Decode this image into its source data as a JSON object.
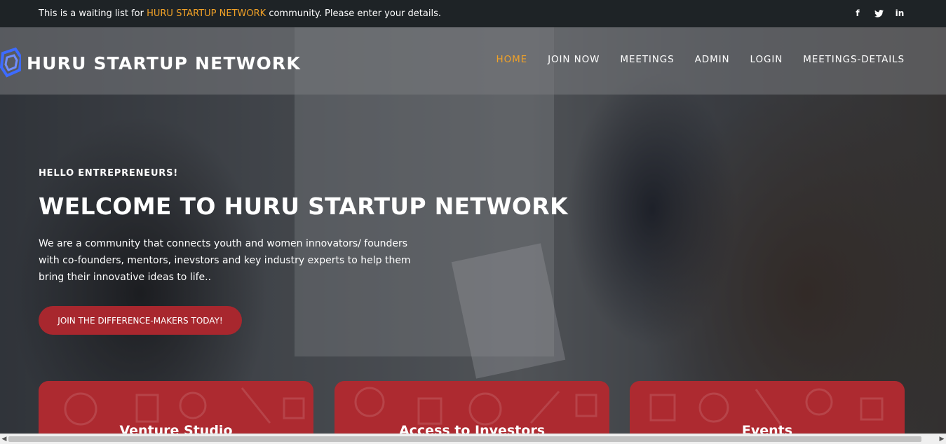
{
  "topbar": {
    "message_prefix": "This is a waiting list for ",
    "message_accent": "HURU STARTUP NETWORK",
    "message_suffix": " community. Please enter your details.",
    "social": [
      {
        "icon": "facebook-icon",
        "glyph": "f"
      },
      {
        "icon": "twitter-icon",
        "glyph": "🐦"
      },
      {
        "icon": "linkedin-icon",
        "glyph": "in"
      }
    ]
  },
  "brand": {
    "name": "HURU STARTUP NETWORK",
    "logo_icon": "hexagon-logo-icon"
  },
  "nav": {
    "items": [
      {
        "label": "HOME",
        "active": true
      },
      {
        "label": "JOIN NOW",
        "active": false
      },
      {
        "label": "MEETINGS",
        "active": false
      },
      {
        "label": "ADMIN",
        "active": false
      },
      {
        "label": "LOGIN",
        "active": false
      },
      {
        "label": "MEETINGS-DETAILS",
        "active": false
      }
    ]
  },
  "hero": {
    "eyebrow": "HELLO ENTREPRENEURS!",
    "headline": "WELCOME TO HURU STARTUP NETWORK",
    "lead": "We are a community that connects youth and women innovators/ founders with co-founders, mentors, inevstors and key industry experts to help them bring their innovative ideas to life..",
    "cta_label": "JOIN THE DIFFERENCE-MAKERS TODAY!"
  },
  "cards": [
    {
      "title": "Venture Studio"
    },
    {
      "title": "Access to Investors"
    },
    {
      "title": "Events"
    }
  ],
  "colors": {
    "accent": "#f2a227",
    "brand_red": "#ad2a30",
    "topbar_bg": "#1e2326",
    "logo_blue": "#3d6bff"
  }
}
